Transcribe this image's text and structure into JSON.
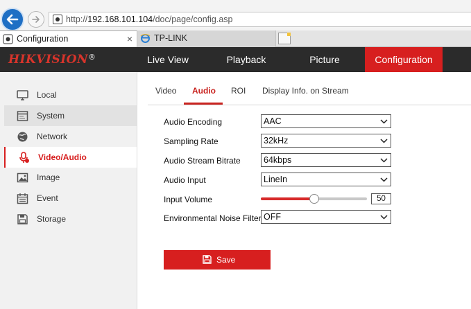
{
  "browser": {
    "url_prefix": "http://",
    "url_host": "192.168.101.104",
    "url_path": "/doc/page/config.asp",
    "tabs": [
      {
        "label": "Configuration",
        "close": "×"
      },
      {
        "label": "TP-LINK"
      }
    ]
  },
  "app": {
    "logo": "HIKVISION",
    "logo_mark": "®",
    "nav": [
      "Live View",
      "Playback",
      "Picture",
      "Configuration"
    ],
    "active_nav": "Configuration"
  },
  "sidebar": {
    "items": [
      {
        "label": "Local",
        "icon": "monitor-icon"
      },
      {
        "label": "System",
        "icon": "window-icon"
      },
      {
        "label": "Network",
        "icon": "globe-icon"
      },
      {
        "label": "Video/Audio",
        "icon": "microphone-icon"
      },
      {
        "label": "Image",
        "icon": "image-icon"
      },
      {
        "label": "Event",
        "icon": "calendar-icon"
      },
      {
        "label": "Storage",
        "icon": "disk-icon"
      }
    ],
    "active": "Video/Audio"
  },
  "subtabs": [
    "Video",
    "Audio",
    "ROI",
    "Display Info. on Stream"
  ],
  "active_subtab": "Audio",
  "form": {
    "audio_encoding": {
      "label": "Audio Encoding",
      "value": "AAC"
    },
    "sampling_rate": {
      "label": "Sampling Rate",
      "value": "32kHz"
    },
    "bitrate": {
      "label": "Audio Stream Bitrate",
      "value": "64kbps"
    },
    "audio_input": {
      "label": "Audio Input",
      "value": "LineIn"
    },
    "input_volume": {
      "label": "Input Volume",
      "value": "50",
      "level": 0.5
    },
    "noise_filter": {
      "label": "Environmental Noise Filter",
      "value": "OFF"
    }
  },
  "save_label": "Save",
  "colors": {
    "accent": "#d71f1f",
    "nav_bg": "#2b2b2b",
    "sidebar_bg": "#f1f1f1"
  }
}
